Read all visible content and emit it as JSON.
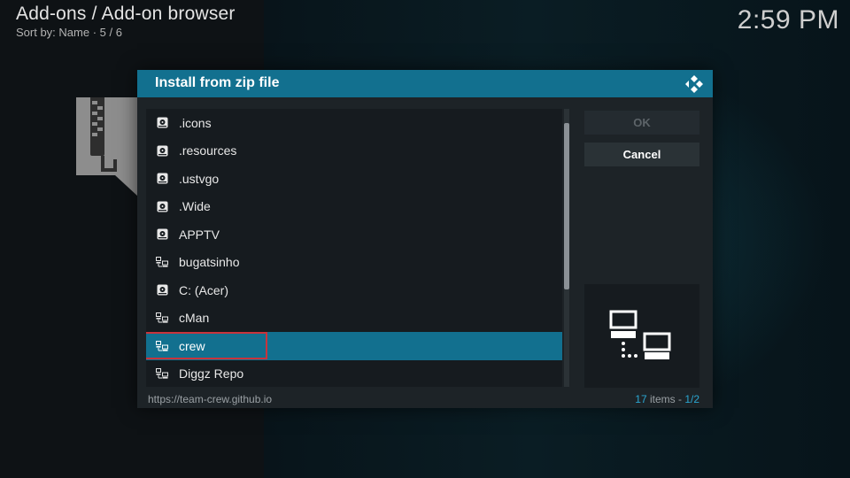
{
  "header": {
    "title": "Add-ons / Add-on browser",
    "subtitle": "Sort by: Name  ·  5 / 6"
  },
  "clock": "2:59 PM",
  "dialog": {
    "title": "Install from zip file",
    "buttons": {
      "ok": "OK",
      "cancel": "Cancel"
    },
    "items": [
      {
        "label": ".icons",
        "icon": "hard-drive-icon"
      },
      {
        "label": ".resources",
        "icon": "hard-drive-icon"
      },
      {
        "label": ".ustvgo",
        "icon": "hard-drive-icon"
      },
      {
        "label": ".Wide",
        "icon": "hard-drive-icon"
      },
      {
        "label": "APPTV",
        "icon": "hard-drive-icon"
      },
      {
        "label": "bugatsinho",
        "icon": "network-source-icon"
      },
      {
        "label": "C: (Acer)",
        "icon": "hard-drive-icon"
      },
      {
        "label": "cMan",
        "icon": "network-source-icon"
      },
      {
        "label": "crew",
        "icon": "network-source-icon",
        "selected": true
      },
      {
        "label": "Diggz Repo",
        "icon": "network-source-icon"
      }
    ],
    "footer": {
      "url": "https://team-crew.github.io",
      "count_number": "17",
      "count_suffix": " items - ",
      "page": "1/2"
    }
  },
  "colors": {
    "accent": "#12708f",
    "selection_outline": "#c8343c",
    "count_highlight": "#2aa6d1"
  }
}
